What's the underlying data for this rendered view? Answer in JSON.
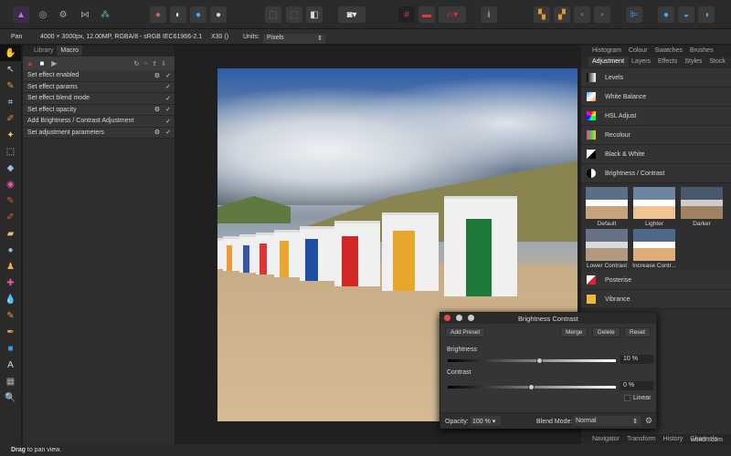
{
  "context": {
    "tool": "Pan",
    "doc_info": "4000 × 3000px, 12.00MP, RGBA/8 - sRGB IEC61966-2.1",
    "camera": "X30 ()",
    "units_label": "Units:",
    "units_value": "Pixels"
  },
  "left_panel": {
    "tabs": [
      "Library",
      "Macro"
    ],
    "active_tab": "Macro",
    "steps": [
      {
        "label": "Set effect enabled",
        "gear": true
      },
      {
        "label": "Set effect params",
        "gear": false
      },
      {
        "label": "Set effect blend mode",
        "gear": false
      },
      {
        "label": "Set effect opacity",
        "gear": true
      },
      {
        "label": "Add Brightness / Contrast Adjustment",
        "gear": false
      },
      {
        "label": "Set adjustment parameters",
        "gear": true
      }
    ]
  },
  "right_panel": {
    "top_tabs": [
      "Histogram",
      "Colour",
      "Swatches",
      "Brushes"
    ],
    "tabs": [
      "Adjustment",
      "Layers",
      "Effects",
      "Styles",
      "Stock"
    ],
    "active_tab": "Adjustment",
    "adjustments": [
      "Levels",
      "White Balance",
      "HSL Adjust",
      "Recolour",
      "Black & White",
      "Brightness / Contrast"
    ],
    "presets": [
      "Default",
      "Lighter",
      "Darker",
      "Lower Contrast",
      "Increase Contr..."
    ],
    "more_adjustments": [
      "Posterise",
      "Vibrance"
    ],
    "bottom_tabs": [
      "Navigator",
      "Transform",
      "History",
      "Channels"
    ]
  },
  "dialog": {
    "title": "Brightness Contrast",
    "add_preset": "Add Preset",
    "merge": "Merge",
    "delete": "Delete",
    "reset": "Reset",
    "brightness_label": "Brightness",
    "brightness_value": "10 %",
    "brightness_level": 10,
    "contrast_label": "Contrast",
    "contrast_value": "0 %",
    "contrast_level": 0,
    "linear_label": "Linear",
    "linear_checked": false,
    "opacity_label": "Opacity:",
    "opacity_value": "100 %",
    "blend_label": "Blend Mode:",
    "blend_value": "Normal"
  },
  "status": {
    "hint_bold": "Drag",
    "hint_rest": " to pan view.",
    "watermark": "wsxdn.com"
  }
}
